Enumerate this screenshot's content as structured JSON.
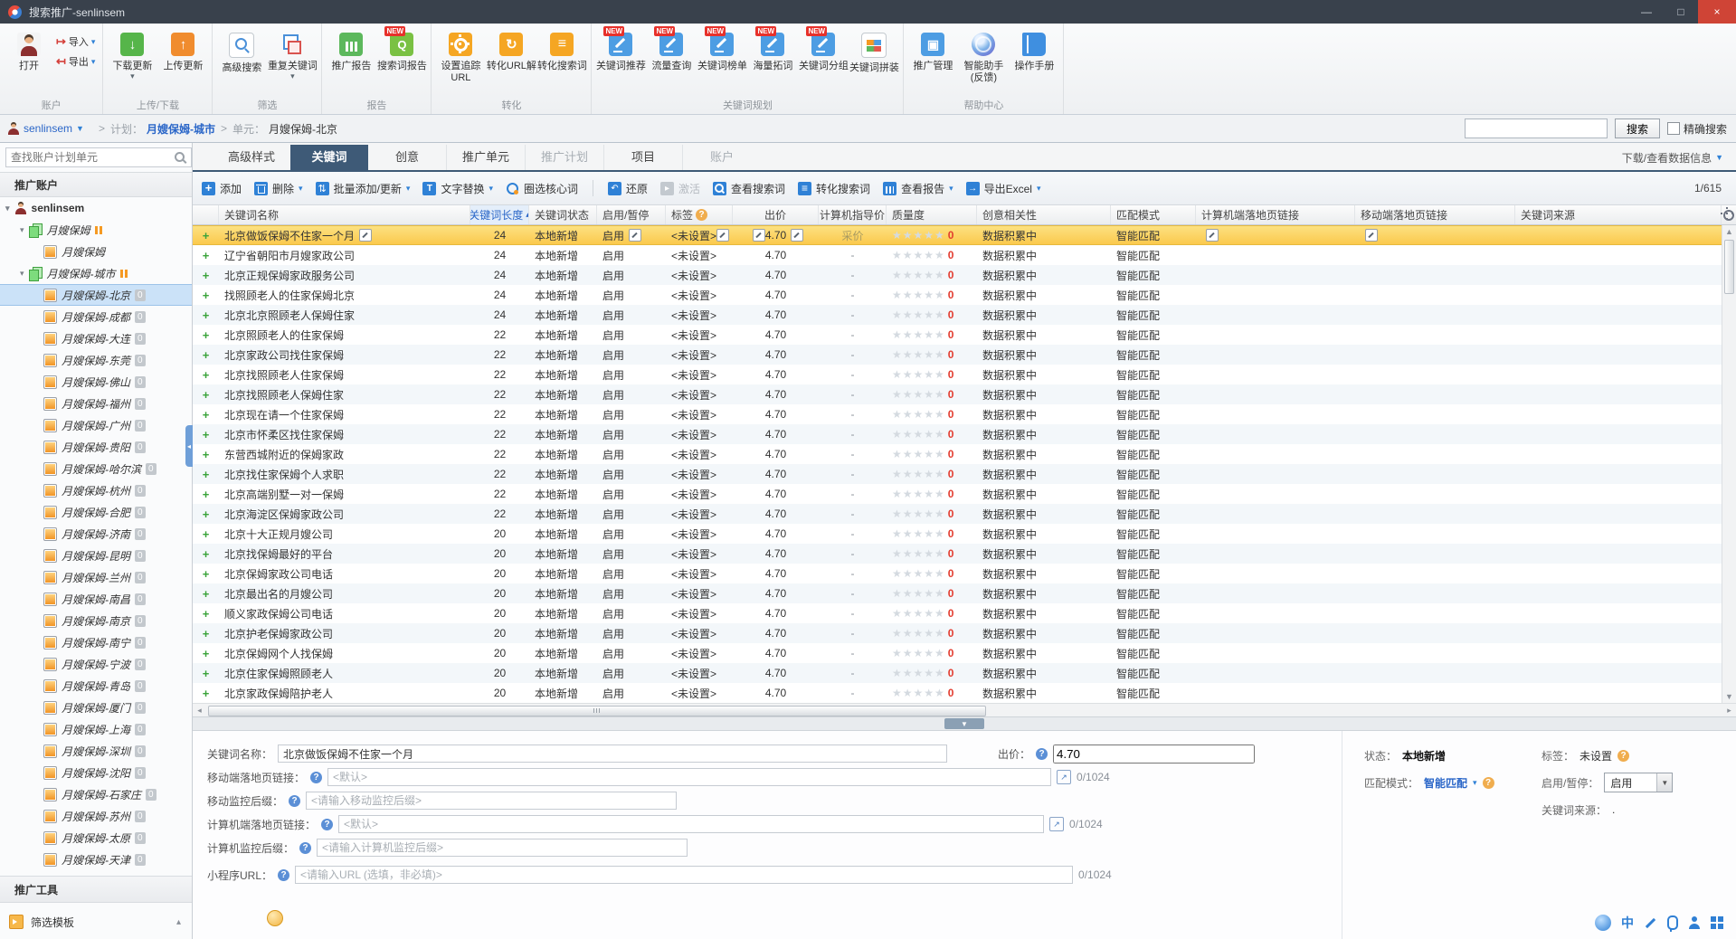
{
  "window": {
    "title": "搜索推广-senlinsem"
  },
  "ribbon": {
    "new_badge": "NEW",
    "account_group": {
      "label": "账户",
      "open": "打开",
      "import": "导入",
      "export": "导出"
    },
    "groups": [
      {
        "label": "上传/下载",
        "buttons": [
          {
            "label": "下载更新",
            "icon": "download",
            "caret": true
          },
          {
            "label": "上传更新",
            "icon": "upload"
          }
        ]
      },
      {
        "label": "筛选",
        "buttons": [
          {
            "label": "高级搜索",
            "icon": "adv-search"
          },
          {
            "label": "重复关键词",
            "icon": "duplicate",
            "caret": true
          }
        ]
      },
      {
        "label": "报告",
        "buttons": [
          {
            "label": "推广报告",
            "icon": "chart"
          },
          {
            "label": "搜索词报告",
            "icon": "report",
            "new": true
          }
        ]
      },
      {
        "label": "转化",
        "buttons": [
          {
            "label": "设置追踪URL",
            "icon": "set-url"
          },
          {
            "label": "转化URL解",
            "icon": "refresh"
          },
          {
            "label": "转化搜索词",
            "icon": "conv-word"
          }
        ]
      },
      {
        "label": "关键词规划",
        "buttons": [
          {
            "label": "关键词推荐",
            "icon": "kw",
            "new": true
          },
          {
            "label": "流量查询",
            "icon": "kw",
            "new": true
          },
          {
            "label": "关键词榜单",
            "icon": "kw",
            "new": true
          },
          {
            "label": "海量拓词",
            "icon": "kw",
            "new": true
          },
          {
            "label": "关键词分组",
            "icon": "kw",
            "new": true
          },
          {
            "label": "关键词拼装",
            "icon": "assemble"
          }
        ]
      },
      {
        "label": "帮助中心",
        "buttons": [
          {
            "label": "推广管理",
            "icon": "manage"
          },
          {
            "label": "智能助手(反馈)",
            "icon": "sphere"
          },
          {
            "label": "操作手册",
            "icon": "book"
          }
        ]
      }
    ]
  },
  "breadcrumb": {
    "user": "senlinsem",
    "sep": ">",
    "plan_label": "计划：",
    "plan_value": "月嫂保姆-城市",
    "unit_label": "单元：",
    "unit_value": "月嫂保姆-北京",
    "search_btn": "搜索",
    "exact_label": "精确搜索"
  },
  "sidebar": {
    "search_placeholder": "查找账户计划单元",
    "header": "推广账户",
    "account": "senlinsem",
    "tools_header": "推广工具",
    "filter_template": "筛选模板",
    "tree": [
      {
        "t": "plan",
        "label": "月嫂保姆",
        "paused": true
      },
      {
        "t": "unit",
        "label": "月嫂保姆"
      },
      {
        "t": "plan",
        "label": "月嫂保姆-城市",
        "paused": true
      },
      {
        "t": "unit",
        "label": "月嫂保姆-北京",
        "badge": "0",
        "selected": true
      },
      {
        "t": "unit",
        "label": "月嫂保姆-成都",
        "badge": "0"
      },
      {
        "t": "unit",
        "label": "月嫂保姆-大连",
        "badge": "0"
      },
      {
        "t": "unit",
        "label": "月嫂保姆-东莞",
        "badge": "0"
      },
      {
        "t": "unit",
        "label": "月嫂保姆-佛山",
        "badge": "0"
      },
      {
        "t": "unit",
        "label": "月嫂保姆-福州",
        "badge": "0"
      },
      {
        "t": "unit",
        "label": "月嫂保姆-广州",
        "badge": "0"
      },
      {
        "t": "unit",
        "label": "月嫂保姆-贵阳",
        "badge": "0"
      },
      {
        "t": "unit",
        "label": "月嫂保姆-哈尔滨",
        "badge": "0"
      },
      {
        "t": "unit",
        "label": "月嫂保姆-杭州",
        "badge": "0"
      },
      {
        "t": "unit",
        "label": "月嫂保姆-合肥",
        "badge": "0"
      },
      {
        "t": "unit",
        "label": "月嫂保姆-济南",
        "badge": "0"
      },
      {
        "t": "unit",
        "label": "月嫂保姆-昆明",
        "badge": "0"
      },
      {
        "t": "unit",
        "label": "月嫂保姆-兰州",
        "badge": "0"
      },
      {
        "t": "unit",
        "label": "月嫂保姆-南昌",
        "badge": "0"
      },
      {
        "t": "unit",
        "label": "月嫂保姆-南京",
        "badge": "0"
      },
      {
        "t": "unit",
        "label": "月嫂保姆-南宁",
        "badge": "0"
      },
      {
        "t": "unit",
        "label": "月嫂保姆-宁波",
        "badge": "0"
      },
      {
        "t": "unit",
        "label": "月嫂保姆-青岛",
        "badge": "0"
      },
      {
        "t": "unit",
        "label": "月嫂保姆-厦门",
        "badge": "0"
      },
      {
        "t": "unit",
        "label": "月嫂保姆-上海",
        "badge": "0"
      },
      {
        "t": "unit",
        "label": "月嫂保姆-深圳",
        "badge": "0"
      },
      {
        "t": "unit",
        "label": "月嫂保姆-沈阳",
        "badge": "0"
      },
      {
        "t": "unit",
        "label": "月嫂保姆-石家庄",
        "badge": "0"
      },
      {
        "t": "unit",
        "label": "月嫂保姆-苏州",
        "badge": "0"
      },
      {
        "t": "unit",
        "label": "月嫂保姆-太原",
        "badge": "0"
      },
      {
        "t": "unit",
        "label": "月嫂保姆-天津",
        "badge": "0"
      }
    ]
  },
  "tabs": {
    "items": [
      {
        "label": "高级样式"
      },
      {
        "label": "关键词",
        "active": true
      },
      {
        "label": "创意"
      },
      {
        "label": "推广单元"
      },
      {
        "label": "推广计划",
        "muted": true
      },
      {
        "label": "项目"
      },
      {
        "label": "账户",
        "muted": true
      }
    ],
    "right_link": "下载/查看数据信息"
  },
  "toolbar": {
    "counter": "1/615",
    "buttons": [
      {
        "label": "添加",
        "icon": "add"
      },
      {
        "label": "删除",
        "icon": "trash",
        "caret": true
      },
      {
        "label": "批量添加/更新",
        "icon": "batch",
        "caret": true
      },
      {
        "label": "文字替换",
        "icon": "text",
        "caret": true
      },
      {
        "label": "圈选核心词",
        "icon": "target"
      },
      {
        "sep": true
      },
      {
        "label": "还原",
        "icon": "undo"
      },
      {
        "label": "激活",
        "icon": "activate",
        "disabled": true
      },
      {
        "label": "查看搜索词",
        "icon": "view-word"
      },
      {
        "label": "转化搜索词",
        "icon": "conv-word"
      },
      {
        "label": "查看报告",
        "icon": "report",
        "caret": true
      },
      {
        "label": "导出Excel",
        "icon": "excel",
        "caret": true
      }
    ]
  },
  "table": {
    "headers": [
      {
        "label": "关键词名称"
      },
      {
        "label": "关键词长度",
        "sorted": true
      },
      {
        "label": "关键词状态"
      },
      {
        "label": "启用/暂停"
      },
      {
        "label": "标签",
        "help": true
      },
      {
        "label": "出价"
      },
      {
        "label": "计算机指导价"
      },
      {
        "label": "质量度"
      },
      {
        "label": "创意相关性"
      },
      {
        "label": "匹配模式"
      },
      {
        "label": "计算机端落地页链接"
      },
      {
        "label": "移动端落地页链接"
      },
      {
        "label": "关键词来源"
      }
    ],
    "defaults": {
      "status": "本地新增",
      "enable": "启用",
      "tag": "<未设置>",
      "bid": "4.70",
      "guide": "-",
      "stars": "★★★★★",
      "quality_zero": "0",
      "creative": "数据积累中",
      "match": "智能匹配"
    },
    "selected_guide_text": "采价",
    "rows": [
      {
        "name": "北京做饭保姆不住家一个月",
        "len": "24",
        "selected": true
      },
      {
        "name": "辽宁省朝阳市月嫂家政公司",
        "len": "24"
      },
      {
        "name": "北京正规保姆家政服务公司",
        "len": "24"
      },
      {
        "name": "找照顾老人的住家保姆北京",
        "len": "24"
      },
      {
        "name": "北京北京照顾老人保姆住家",
        "len": "24"
      },
      {
        "name": "北京照顾老人的住家保姆",
        "len": "22"
      },
      {
        "name": "北京家政公司找住家保姆",
        "len": "22"
      },
      {
        "name": "北京找照顾老人住家保姆",
        "len": "22"
      },
      {
        "name": "北京找照顾老人保姆住家",
        "len": "22"
      },
      {
        "name": "北京现在请一个住家保姆",
        "len": "22"
      },
      {
        "name": "北京市怀柔区找住家保姆",
        "len": "22"
      },
      {
        "name": "东营西城附近的保姆家政",
        "len": "22"
      },
      {
        "name": "北京找住家保姆个人求职",
        "len": "22"
      },
      {
        "name": "北京高端别墅一对一保姆",
        "len": "22"
      },
      {
        "name": "北京海淀区保姆家政公司",
        "len": "22"
      },
      {
        "name": "北京十大正规月嫂公司",
        "len": "20"
      },
      {
        "name": "北京找保姆最好的平台",
        "len": "20"
      },
      {
        "name": "北京保姆家政公司电话",
        "len": "20"
      },
      {
        "name": "北京最出名的月嫂公司",
        "len": "20"
      },
      {
        "name": "顺义家政保姆公司电话",
        "len": "20"
      },
      {
        "name": "北京护老保姆家政公司",
        "len": "20"
      },
      {
        "name": "北京保姆网个人找保姆",
        "len": "20"
      },
      {
        "name": "北京住家保姆照顾老人",
        "len": "20"
      },
      {
        "name": "北京家政保姆陪护老人",
        "len": "20"
      }
    ]
  },
  "detail": {
    "name_label": "关键词名称：",
    "name_value": "北京做饭保姆不住家一个月",
    "bid_label": "出价：",
    "bid_value": "4.70",
    "mobile_link_label": "移动端落地页链接：",
    "mobile_link_placeholder": "<默认>",
    "mobile_link_count": "0/1024",
    "mobile_suffix_label": "移动监控后缀：",
    "mobile_suffix_placeholder": "<请输入移动监控后缀>",
    "pc_link_label": "计算机端落地页链接：",
    "pc_link_placeholder": "<默认>",
    "pc_link_count": "0/1024",
    "pc_suffix_label": "计算机监控后缀：",
    "pc_suffix_placeholder": "<请输入计算机监控后缀>",
    "miniapp_label": "小程序URL：",
    "miniapp_placeholder": "<请输入URL (选填，非必填)>",
    "miniapp_count": "0/1024",
    "status_label": "状态：",
    "status_value": "本地新增",
    "match_label": "匹配模式：",
    "match_value": "智能匹配",
    "tag_label": "标签：",
    "tag_value": "未设置",
    "enable_label": "启用/暂停：",
    "enable_value": "启用",
    "source_label": "关键词来源：",
    "source_value": "."
  },
  "ime": {
    "zh": "中"
  }
}
